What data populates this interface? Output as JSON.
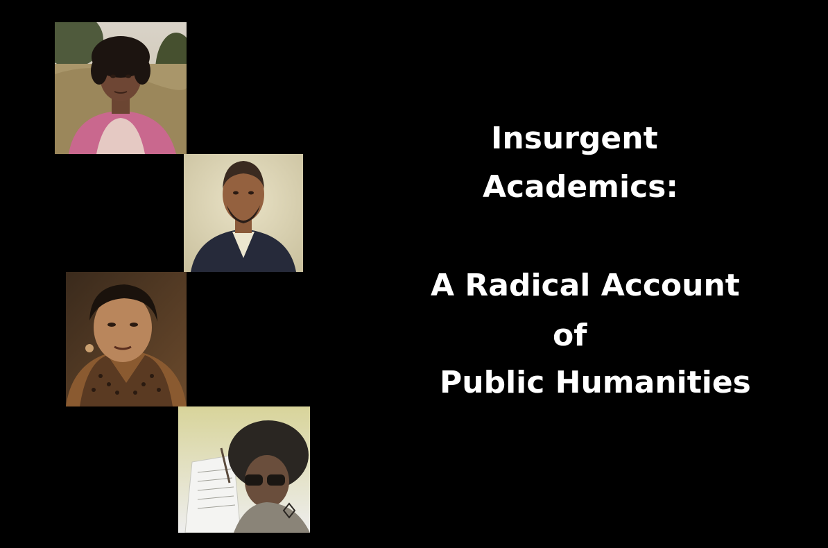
{
  "title": {
    "line1": "Insurgent",
    "line2": "Academics:",
    "line3": "A Radical Account",
    "line4": "of",
    "line5": "Public Humanities"
  },
  "colors": {
    "background": "#000000",
    "text": "#ffffff"
  }
}
